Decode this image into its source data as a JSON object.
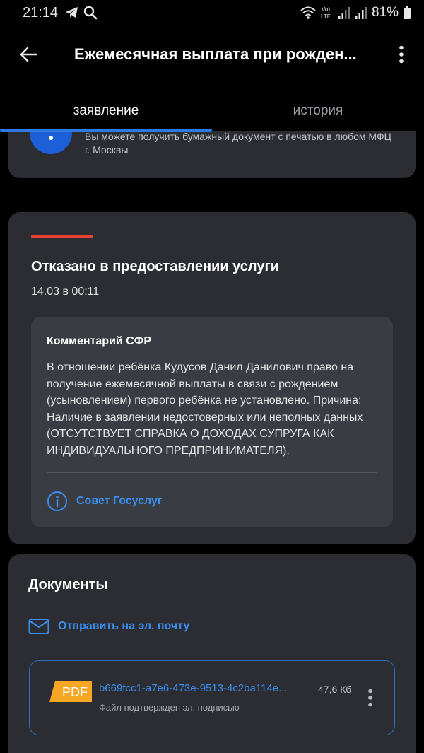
{
  "status_bar": {
    "time": "21:14",
    "battery": "81%",
    "icons": [
      "telegram-icon",
      "search-icon",
      "wifi-icon",
      "volte-icon",
      "signal-icon",
      "signal-icon",
      "battery-icon"
    ]
  },
  "header": {
    "title": "Ежемесячная выплата при рожден...",
    "back_icon": "arrow-left-icon",
    "menu_icon": "more-vertical-icon"
  },
  "tabs": [
    {
      "label": "заявление",
      "active": true
    },
    {
      "label": "история",
      "active": false
    }
  ],
  "info_card": {
    "text": "Вы можете получить бумажный документ с печатью в любом МФЦ г. Москвы"
  },
  "status": {
    "title": "Отказано в предоставлении услуги",
    "datetime": "14.03 в 00:11",
    "accent_color": "#e4412f",
    "comment": {
      "title": "Комментарий СФР",
      "text": "В отношении ребёнка Кудусов Данил Данилович право на получение ежемесячной выплаты в связи с рождением (усыновлением) первого ребёнка не установлено. Причина: Наличие в заявлении недостоверных или неполных данных (ОТСУТСТВУЕТ СПРАВКА О ДОХОДАХ СУПРУГА КАК ИНДИВИДУАЛЬНОГО ПРЕДПРИНИМАТЕЛЯ).",
      "tip_label": "Совет Госуслуг"
    }
  },
  "documents": {
    "title": "Документы",
    "send_email_label": "Отправить на эл. почту",
    "files": [
      {
        "badge": "PDF",
        "name": "b669fcc1-a7e6-473e-9513-4c2ba114e...",
        "size": "47,6 Кб",
        "subtitle": "Файл подтвержден эл. подписью"
      }
    ]
  },
  "colors": {
    "accent_blue": "#3a8ef0",
    "card_bg": "#2b2d33",
    "pdf_orange": "#f5a623"
  }
}
